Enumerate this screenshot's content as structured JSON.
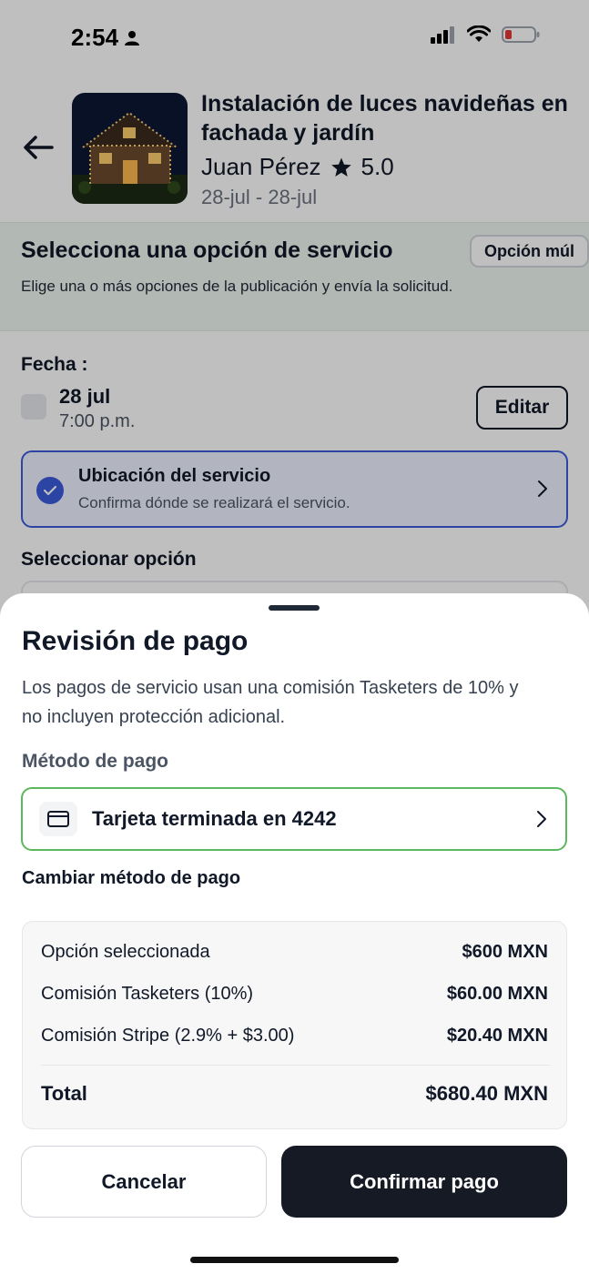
{
  "status_bar": {
    "time": "2:54"
  },
  "service": {
    "title": "Instalación de luces navideñas en fachada y jardín",
    "provider": "Juan Pérez",
    "rating": "5.0",
    "dates": "28-jul - 28-jul"
  },
  "selection": {
    "title": "Selecciona una opción de servicio",
    "badge": "Opción múl",
    "subtitle": "Elige una o más opciones de la publicación y envía la solicitud."
  },
  "date_section": {
    "label": "Fecha :",
    "day": "28 jul",
    "time": "7:00 p.m.",
    "edit_label": "Editar"
  },
  "location": {
    "title": "Ubicación del servicio",
    "subtitle": "Confirma dónde se realizará el servicio."
  },
  "select_option_label": "Seleccionar opción",
  "payment_sheet": {
    "title": "Revisión de pago",
    "description": "Los pagos de servicio usan una comisión Tasketers de 10% y no incluyen protección adicional.",
    "method_label": "Método de pago",
    "card_text": "Tarjeta terminada en 4242",
    "change_method": "Cambiar método de pago",
    "summary": [
      {
        "label": "Opción seleccionada",
        "amount": "$600 MXN"
      },
      {
        "label": "Comisión Tasketers (10%)",
        "amount": "$60.00 MXN"
      },
      {
        "label": "Comisión Stripe (2.9% + $3.00)",
        "amount": "$20.40 MXN"
      }
    ],
    "total_label": "Total",
    "total_amount": "$680.40 MXN",
    "cancel_label": "Cancelar",
    "confirm_label": "Confirmar pago"
  },
  "colors": {
    "accent_blue": "#3b5bdb",
    "selected_green": "#5cb85c",
    "primary_dark": "#151a24",
    "banner_green": "#eef6ef"
  }
}
